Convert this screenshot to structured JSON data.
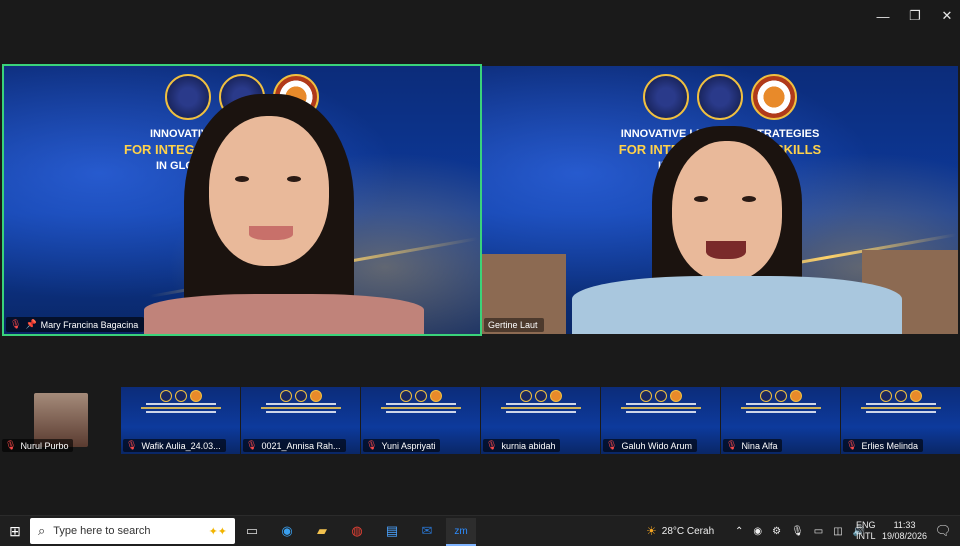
{
  "window": {
    "controls": {
      "minimize": "—",
      "restore": "❐",
      "close": "✕"
    }
  },
  "banner": {
    "line1": "INNOVATIVE LEARNING STRATEGIES",
    "line2": "FOR INTEGRATING 21st CENTURY SKILLS",
    "line3": "IN GLOBAL EDUCATION CONTEXTS",
    "left_visible": {
      "line1": "INNOVATIVE LEA",
      "line2": "FOR INTEGRATING",
      "line3": "IN GLOBAL E"
    },
    "right_visible": {
      "line1": "INNOVATIVE LEARNING STRATEGIES",
      "line2": "FOR INTEGRA        TURY SKILLS",
      "line3": "IN GLOB              TEXTS"
    }
  },
  "participants_main": [
    {
      "name": "Mary Francina Bagacina",
      "muted": true,
      "pinned": true,
      "active_speaker": true
    },
    {
      "name": "Gertine Laut",
      "muted": false,
      "pinned": false
    }
  ],
  "participants_strip": [
    {
      "name": "Nurul Purbo",
      "muted": true
    },
    {
      "name": "Wafik Aulia_24.03...",
      "muted": true
    },
    {
      "name": "0021_Annisa Rah...",
      "muted": true
    },
    {
      "name": "Yuni Aspriyati",
      "muted": true
    },
    {
      "name": "kurnia abidah",
      "muted": true
    },
    {
      "name": "Galuh Wido Arum",
      "muted": true
    },
    {
      "name": "Nina Alfa",
      "muted": true
    },
    {
      "name": "Erlies Melinda",
      "muted": true
    }
  ],
  "taskbar": {
    "search_placeholder": "Type here to search",
    "weather": "28°C  Cerah",
    "lang_top": "ENG",
    "lang_bottom": "INTL",
    "time": "11:33",
    "date": "19/08/2026"
  },
  "colors": {
    "active_speaker_border": "#3ad37a",
    "muted_red": "#ff4a4a",
    "banner_yellow": "#ffd24a",
    "banner_blue": "#0d3a9c"
  }
}
